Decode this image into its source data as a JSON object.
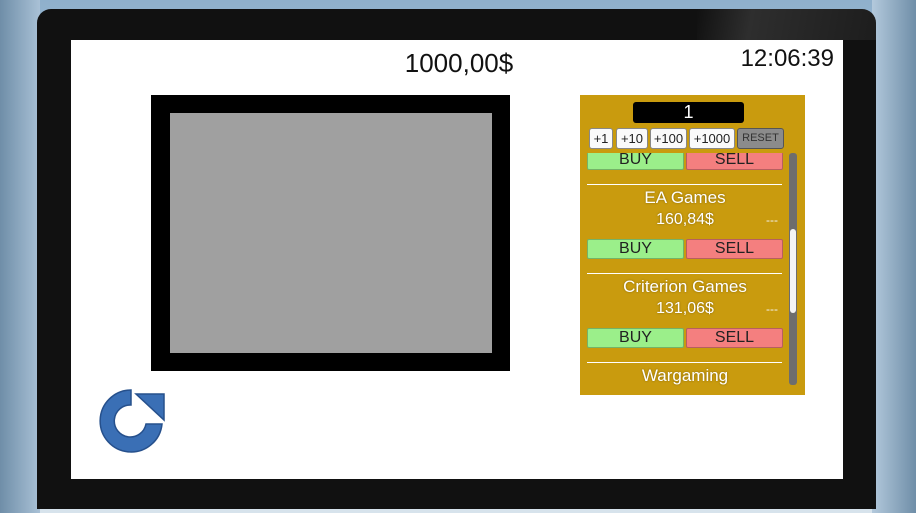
{
  "hud": {
    "money": "1000,00$",
    "clock": "12:06:39"
  },
  "trade_panel": {
    "quantity": "1",
    "increments": [
      "+1",
      "+10",
      "+100",
      "+1000"
    ],
    "reset_label": "RESET",
    "buy_label": "BUY",
    "sell_label": "SELL",
    "companies": [
      {
        "name": "EA Games",
        "price": "160,84$",
        "change": "---"
      },
      {
        "name": "Criterion Games",
        "price": "131,06$",
        "change": "---"
      },
      {
        "name": "Wargaming"
      }
    ]
  },
  "colors": {
    "panel": "#c99b0e",
    "buy": "#9bef8a",
    "sell": "#f47f7f",
    "refresh_icon": "#3a6fb5",
    "monitor_display": "#a0a0a0"
  },
  "icons": {
    "refresh": "refresh-icon"
  }
}
